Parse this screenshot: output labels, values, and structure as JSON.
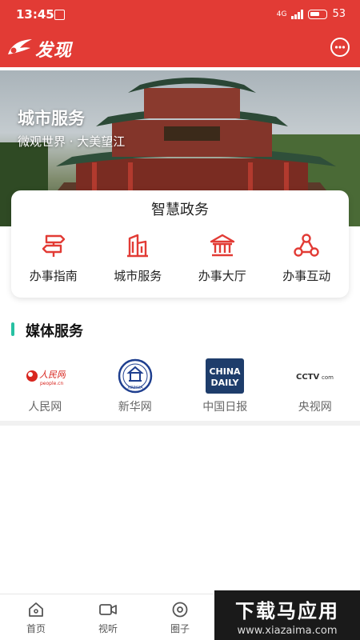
{
  "status_bar": {
    "time": "13:45",
    "network": "4G",
    "battery": "53"
  },
  "header": {
    "title": "发现"
  },
  "banner": {
    "title": "城市服务",
    "subtitle": "微观世界 · 大美望江"
  },
  "gov_services": {
    "title": "智慧政务",
    "items": [
      {
        "label": "办事指南",
        "icon": "signpost-icon"
      },
      {
        "label": "城市服务",
        "icon": "buildings-icon"
      },
      {
        "label": "办事大厅",
        "icon": "hall-icon"
      },
      {
        "label": "办事互动",
        "icon": "interaction-icon"
      }
    ]
  },
  "media": {
    "title": "媒体服务",
    "items": [
      {
        "label": "人民网",
        "logo_text": "人民网",
        "logo_sub": "people.cn"
      },
      {
        "label": "新华网",
        "logo_text": "XINHUA"
      },
      {
        "label": "中国日报",
        "logo_text": "CHINA",
        "logo_text2": "DAILY"
      },
      {
        "label": "央视网",
        "logo_text": "CCTV",
        "logo_sub": "com"
      }
    ]
  },
  "tabs": [
    {
      "label": "首页",
      "icon": "home-icon"
    },
    {
      "label": "视听",
      "icon": "video-icon"
    },
    {
      "label": "圈子",
      "icon": "circle-icon"
    }
  ],
  "watermark": {
    "main": "下载马应用",
    "sub": "www.xiazaima.com"
  },
  "colors": {
    "brand": "#e23b35",
    "accent": "#27c1a2"
  }
}
